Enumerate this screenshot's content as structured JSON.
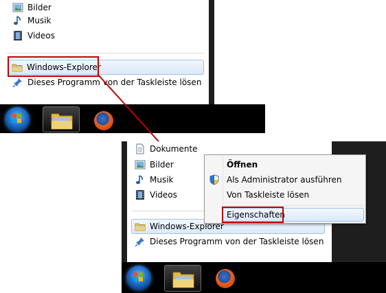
{
  "top_menu": {
    "items": [
      {
        "label": "Bilder",
        "icon": "pictures-icon"
      },
      {
        "label": "Musik",
        "icon": "music-icon"
      },
      {
        "label": "Videos",
        "icon": "videos-icon"
      }
    ],
    "pinned_program": "Windows-Explorer",
    "unpin_label": "Dieses Programm von der Taskleiste lösen"
  },
  "bottom_menu": {
    "items": [
      {
        "label": "Dokumente",
        "icon": "documents-icon"
      },
      {
        "label": "Bilder",
        "icon": "pictures-icon"
      },
      {
        "label": "Musik",
        "icon": "music-icon"
      },
      {
        "label": "Videos",
        "icon": "videos-icon"
      }
    ],
    "pinned_program": "Windows-Explorer",
    "unpin_label": "Dieses Programm von der Taskleiste lösen"
  },
  "context_menu": {
    "open": "Öffnen",
    "run_as_admin": "Als Administrator ausführen",
    "unpin": "Von Taskleiste lösen",
    "properties": "Eigenschaften"
  },
  "colors": {
    "highlight_border": "#c00000",
    "arrow": "#c00000",
    "taskbar": "#000000"
  }
}
